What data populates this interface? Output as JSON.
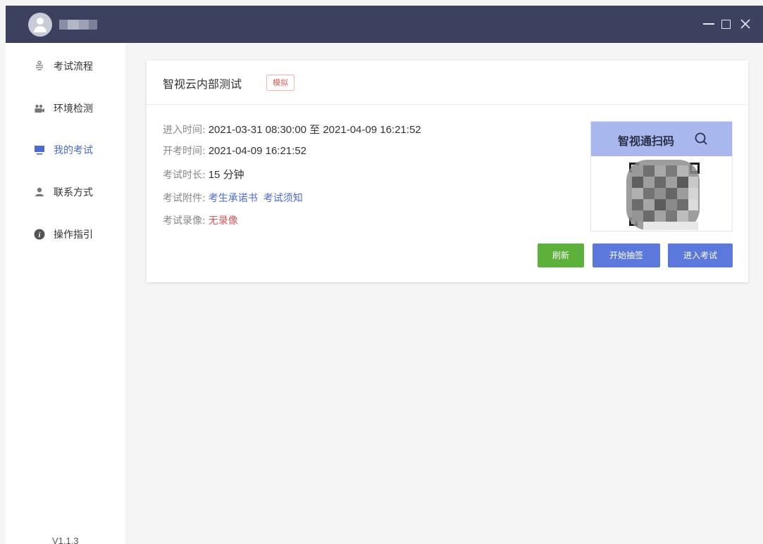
{
  "window": {
    "minimize_icon": "minimize-icon",
    "maximize_icon": "maximize-icon",
    "close_icon": "close-icon"
  },
  "sidebar": {
    "items": [
      {
        "label": "考试流程",
        "icon": "flow-icon",
        "active": false
      },
      {
        "label": "环境检测",
        "icon": "camera-icon",
        "active": false
      },
      {
        "label": "我的考试",
        "icon": "monitor-icon",
        "active": true
      },
      {
        "label": "联系方式",
        "icon": "user-icon",
        "active": false
      },
      {
        "label": "操作指引",
        "icon": "info-icon",
        "active": false
      }
    ],
    "version": "V1.1.3"
  },
  "exam": {
    "title": "智视云内部测试",
    "badge": "模拟",
    "entry_time_label": "进入时间:",
    "entry_time_value": "2021-03-31 08:30:00 至 2021-04-09 16:21:52",
    "start_time_label": "开考时间:",
    "start_time_value": "2021-04-09 16:21:52",
    "duration_label": "考试时长:",
    "duration_value": "15 分钟",
    "attachments_label": "考试附件:",
    "attachments": [
      "考生承诺书",
      "考试须知"
    ],
    "recording_label": "考试录像:",
    "recording_value": "无录像",
    "qr_title": "智视通扫码"
  },
  "actions": {
    "refresh": "刷新",
    "draw": "开始抽签",
    "enter": "进入考试"
  },
  "colors": {
    "titlebar": "#3c4160",
    "accent": "#4a6ad6",
    "green": "#5cb13b",
    "danger": "#e05555",
    "qr_header": "#a8b8ef"
  }
}
